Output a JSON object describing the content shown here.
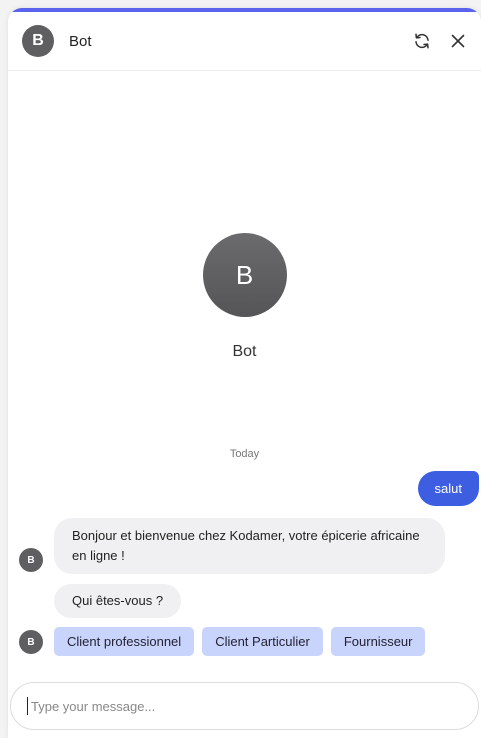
{
  "header": {
    "avatar_letter": "B",
    "title": "Bot"
  },
  "icons": {
    "refresh": "refresh-icon",
    "close": "close-icon"
  },
  "hero": {
    "avatar_letter": "B",
    "name": "Bot"
  },
  "conversation": {
    "date_separator": "Today",
    "user_message": "salut",
    "bot_messages": [
      "Bonjour et bienvenue chez Kodamer, votre épicerie africaine en ligne !",
      "Qui êtes-vous ?"
    ],
    "bot_avatar_letter": "B",
    "quick_replies": [
      "Client professionnel",
      "Client Particulier",
      "Fournisseur"
    ]
  },
  "composer": {
    "placeholder": "Type your message..."
  },
  "colors": {
    "accent": "#5a63ee",
    "user_bubble": "#3d5ee1",
    "quick_reply": "#c8d4fb",
    "avatar": "#5f5f61"
  }
}
